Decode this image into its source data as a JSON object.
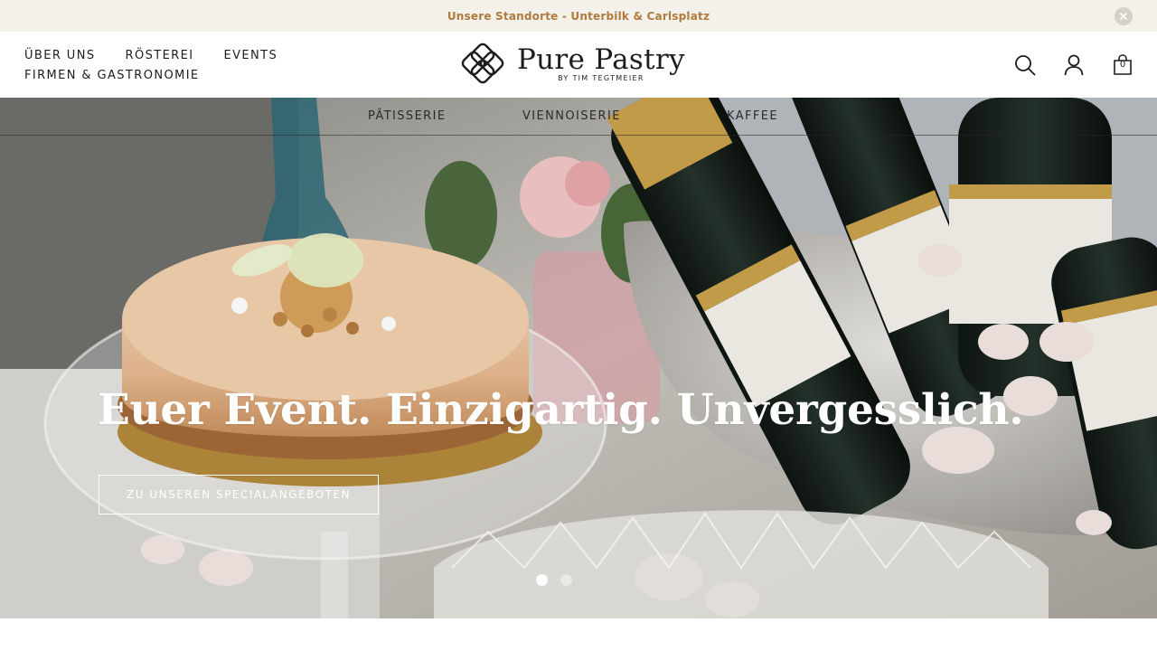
{
  "announcement": {
    "text": "Unsere Standorte - Unterbilk & Carlsplatz",
    "close_icon": "close-icon"
  },
  "header": {
    "nav_row1": [
      "ÜBER UNS",
      "RÖSTEREI",
      "EVENTS"
    ],
    "nav_row2": [
      "FIRMEN & GASTRONOMIE"
    ],
    "logo": {
      "name": "Pure Pastry",
      "subtitle": "BY TIM TEGTMEIER",
      "icon": "knot-logo-icon"
    },
    "icons": [
      "search-icon",
      "user-icon",
      "cart-icon"
    ],
    "cart_count": "0"
  },
  "hero": {
    "subnav": [
      "PÂTISSERIE",
      "VIENNOISERIE",
      "KAFFEE"
    ],
    "title": "Euer Event. Einzigartig. Unvergesslich.",
    "cta": "ZU UNSEREN SPECIALANGEBOTEN",
    "slides": {
      "count": 2,
      "active": 1
    },
    "image_description_icon": "hero-photo-cake-and-champagne"
  },
  "colors": {
    "announcement_bg": "#f3f1ea",
    "announcement_text": "#b07a3c",
    "text_dark": "#1d1d1b",
    "white": "#ffffff"
  }
}
